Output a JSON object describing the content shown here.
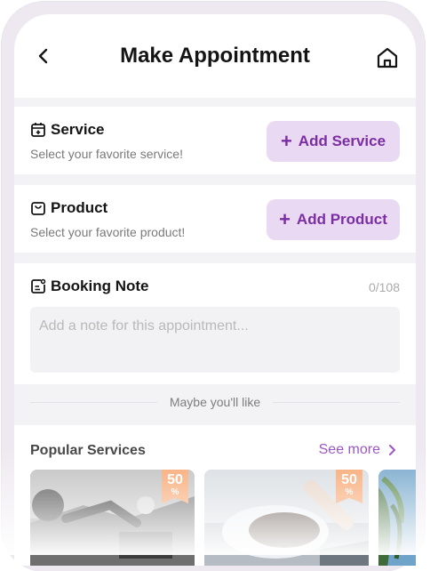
{
  "header": {
    "title": "Make Appointment",
    "back_icon": "chevron-left-icon",
    "home_icon": "home-icon"
  },
  "service": {
    "title": "Service",
    "subtitle": "Select your favorite service!",
    "icon": "calendar-plus-icon",
    "button_plus": "+",
    "button_label": "Add Service"
  },
  "product": {
    "title": "Product",
    "subtitle": "Select your favorite product!",
    "icon": "shopping-bag-icon",
    "button_plus": "+",
    "button_label": "Add Product"
  },
  "booking_note": {
    "title": "Booking Note",
    "icon": "note-edit-icon",
    "counter": "0/108",
    "placeholder": "Add a note for this appointment..."
  },
  "suggestion_divider": "Maybe you'll like",
  "popular": {
    "title": "Popular Services",
    "see_more": "See more",
    "items": [
      {
        "discount": "50",
        "unit": "%",
        "image": "exercise-photo"
      },
      {
        "discount": "50",
        "unit": "%",
        "image": "hair-wash-photo"
      },
      {
        "image": "palm-tree-photo"
      }
    ]
  },
  "colors": {
    "accent": "#7b2ea3",
    "button_bg": "#ead9f3",
    "badge": "#f6a26a",
    "see_more": "#9a55c4"
  }
}
